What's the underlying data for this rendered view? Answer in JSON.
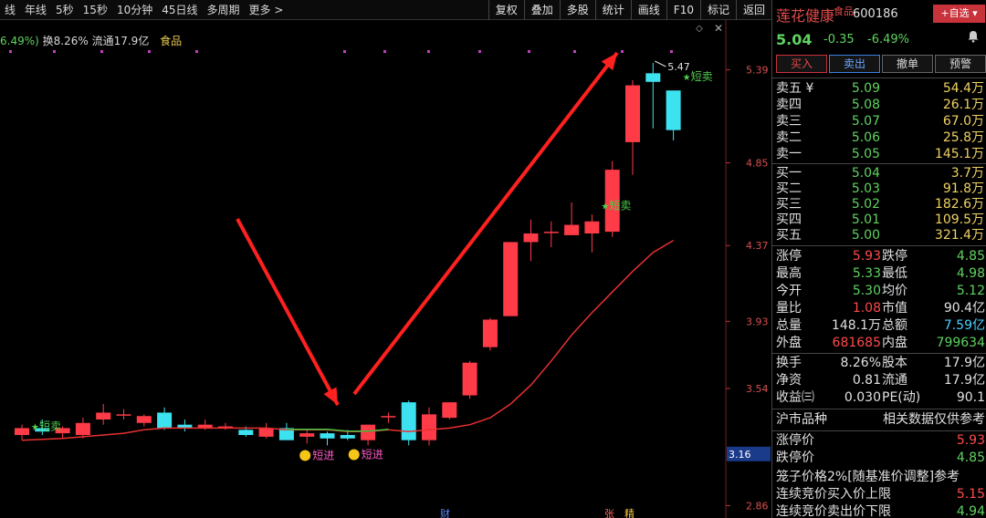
{
  "toolbar": {
    "periods": [
      "线",
      "年线",
      "5秒",
      "15秒",
      "10分钟",
      "45日线",
      "多周期",
      "更多 >"
    ],
    "buttons": [
      "复权",
      "叠加",
      "多股",
      "统计",
      "画线",
      "F10",
      "标记",
      "返回"
    ]
  },
  "info": {
    "change": "6.49%)",
    "turnover": "换8.26%",
    "float": "流通17.9亿",
    "industry": "食品"
  },
  "chart": {
    "price_labels": [
      "5.39",
      "4.85",
      "4.37",
      "3.93",
      "3.54",
      "2.86"
    ],
    "last_price_tag": "3.16",
    "high_label": "5.47",
    "annotations": {
      "short_sell": "短卖",
      "short_buy": "短进"
    },
    "bottom_marks": [
      "财",
      "张",
      "精"
    ]
  },
  "chart_data": {
    "type": "candlestick",
    "ylim": [
      2.82,
      5.52
    ],
    "grid": false,
    "candles": [
      {
        "o": 3.27,
        "h": 3.33,
        "l": 3.24,
        "c": 3.31
      },
      {
        "o": 3.31,
        "h": 3.36,
        "l": 3.27,
        "c": 3.29
      },
      {
        "o": 3.28,
        "h": 3.32,
        "l": 3.25,
        "c": 3.31
      },
      {
        "o": 3.27,
        "h": 3.37,
        "l": 3.25,
        "c": 3.34
      },
      {
        "o": 3.36,
        "h": 3.45,
        "l": 3.33,
        "c": 3.4
      },
      {
        "o": 3.39,
        "h": 3.42,
        "l": 3.36,
        "c": 3.39
      },
      {
        "o": 3.34,
        "h": 3.39,
        "l": 3.32,
        "c": 3.38
      },
      {
        "o": 3.4,
        "h": 3.43,
        "l": 3.3,
        "c": 3.31
      },
      {
        "o": 3.33,
        "h": 3.36,
        "l": 3.29,
        "c": 3.31
      },
      {
        "o": 3.31,
        "h": 3.36,
        "l": 3.3,
        "c": 3.33
      },
      {
        "o": 3.32,
        "h": 3.34,
        "l": 3.3,
        "c": 3.32
      },
      {
        "o": 3.3,
        "h": 3.32,
        "l": 3.26,
        "c": 3.27
      },
      {
        "o": 3.26,
        "h": 3.34,
        "l": 3.25,
        "c": 3.31
      },
      {
        "o": 3.31,
        "h": 3.34,
        "l": 3.24,
        "c": 3.24
      },
      {
        "o": 3.26,
        "h": 3.3,
        "l": 3.22,
        "c": 3.28
      },
      {
        "o": 3.28,
        "h": 3.29,
        "l": 3.21,
        "c": 3.25
      },
      {
        "o": 3.27,
        "h": 3.3,
        "l": 3.24,
        "c": 3.25
      },
      {
        "o": 3.24,
        "h": 3.33,
        "l": 3.21,
        "c": 3.33
      },
      {
        "o": 3.38,
        "h": 3.4,
        "l": 3.34,
        "c": 3.38
      },
      {
        "o": 3.46,
        "h": 3.47,
        "l": 3.21,
        "c": 3.24
      },
      {
        "o": 3.24,
        "h": 3.43,
        "l": 3.21,
        "c": 3.39
      },
      {
        "o": 3.37,
        "h": 3.46,
        "l": 3.36,
        "c": 3.46
      },
      {
        "o": 3.5,
        "h": 3.7,
        "l": 3.48,
        "c": 3.69
      },
      {
        "o": 3.78,
        "h": 3.95,
        "l": 3.76,
        "c": 3.94
      },
      {
        "o": 3.96,
        "h": 4.39,
        "l": 3.96,
        "c": 4.39
      },
      {
        "o": 4.39,
        "h": 4.52,
        "l": 4.28,
        "c": 4.44
      },
      {
        "o": 4.45,
        "h": 4.51,
        "l": 4.36,
        "c": 4.45
      },
      {
        "o": 4.43,
        "h": 4.62,
        "l": 4.43,
        "c": 4.49
      },
      {
        "o": 4.44,
        "h": 4.55,
        "l": 4.33,
        "c": 4.51
      },
      {
        "o": 4.45,
        "h": 4.86,
        "l": 4.42,
        "c": 4.81
      },
      {
        "o": 4.97,
        "h": 5.33,
        "l": 4.78,
        "c": 5.3
      },
      {
        "o": 5.37,
        "h": 5.43,
        "l": 5.05,
        "c": 5.32
      },
      {
        "o": 5.27,
        "h": 5.27,
        "l": 4.98,
        "c": 5.04
      }
    ],
    "ma": [
      3.24,
      3.245,
      3.25,
      3.26,
      3.27,
      3.28,
      3.3,
      3.31,
      3.31,
      3.31,
      3.31,
      3.31,
      3.31,
      3.3,
      3.3,
      3.3,
      3.29,
      3.29,
      3.3,
      3.29,
      3.3,
      3.31,
      3.33,
      3.37,
      3.45,
      3.56,
      3.7,
      3.85,
      3.98,
      4.1,
      4.22,
      4.33,
      4.4
    ]
  },
  "quote": {
    "name": "莲花健康",
    "tag": "食品",
    "code": "600186",
    "add_label": "+自选 ▾",
    "price": "5.04",
    "change": "-0.35",
    "pct": "-6.49%",
    "actions": [
      "买入",
      "卖出",
      "撤单",
      "预警"
    ]
  },
  "sell_orders": [
    {
      "label": "卖五 ¥",
      "price": "5.09",
      "vol": "54.4万"
    },
    {
      "label": "卖四",
      "price": "5.08",
      "vol": "26.1万"
    },
    {
      "label": "卖三",
      "price": "5.07",
      "vol": "67.0万"
    },
    {
      "label": "卖二",
      "price": "5.06",
      "vol": "25.8万"
    },
    {
      "label": "卖一",
      "price": "5.05",
      "vol": "145.1万"
    }
  ],
  "buy_orders": [
    {
      "label": "买一",
      "price": "5.04",
      "vol": "3.7万"
    },
    {
      "label": "买二",
      "price": "5.03",
      "vol": "91.8万"
    },
    {
      "label": "买三",
      "price": "5.02",
      "vol": "182.6万"
    },
    {
      "label": "买四",
      "price": "5.01",
      "vol": "109.5万"
    },
    {
      "label": "买五",
      "price": "5.00",
      "vol": "321.4万"
    }
  ],
  "stats1": [
    {
      "k1": "涨停",
      "v1": "5.93",
      "k2": "跌停",
      "v2": "4.85"
    },
    {
      "k1": "最高",
      "v1": "5.33",
      "k2": "最低",
      "v2": "4.98"
    },
    {
      "k1": "今开",
      "v1": "5.30",
      "k2": "均价",
      "v2": "5.12"
    },
    {
      "k1": "量比",
      "v1": "1.08",
      "k2": "市值",
      "v2": "90.4亿"
    },
    {
      "k1": "总量",
      "v1": "148.1万",
      "k2": "总额",
      "v2": "7.59亿"
    },
    {
      "k1": "外盘",
      "v1": "681685",
      "k2": "内盘",
      "v2": "799634"
    }
  ],
  "stats2": [
    {
      "k1": "换手",
      "v1": "8.26%",
      "k2": "股本",
      "v2": "17.9亿"
    },
    {
      "k1": "净资",
      "v1": "0.81",
      "k2": "流通",
      "v2": "17.9亿"
    },
    {
      "k1": "收益㈢",
      "v1": "0.030",
      "k2": "PE(动)",
      "v2": "90.1"
    }
  ],
  "extra": {
    "header_left": "沪市品种",
    "header_right": "相关数据仅供参考",
    "limit_up_label": "涨停价",
    "limit_up": "5.93",
    "limit_down_label": "跌停价",
    "limit_down": "4.85",
    "cage": "笼子价格2%[随基准价调整]参考",
    "auction_buy_label": "连续竞价买入价上限",
    "auction_buy": "5.15",
    "auction_sell_label": "连续竞价卖出价下限",
    "auction_sell": "4.94"
  }
}
